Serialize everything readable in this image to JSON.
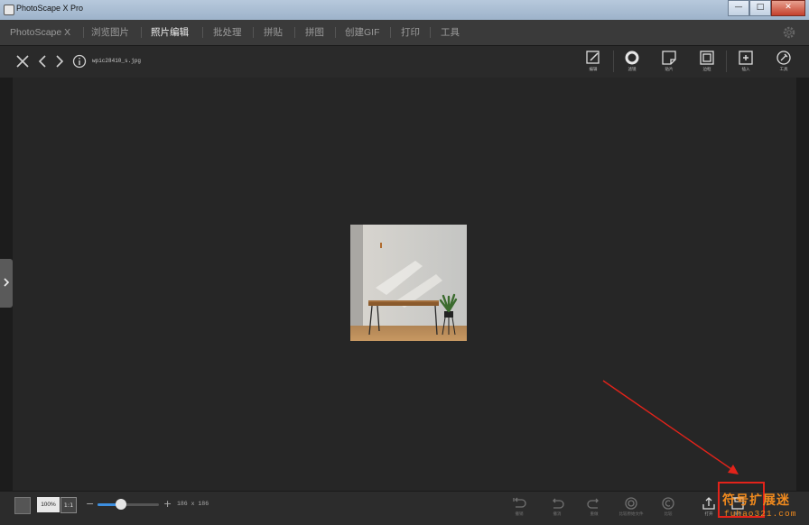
{
  "window": {
    "title": "PhotoScape X Pro",
    "controls": {
      "minimize": "—",
      "maximize": "□",
      "close": "✕"
    }
  },
  "menu": {
    "tabs": [
      {
        "label": "PhotoScape X",
        "active": false
      },
      {
        "label": "浏览图片",
        "active": false
      },
      {
        "label": "照片编辑",
        "active": true
      },
      {
        "label": "批处理",
        "active": false
      },
      {
        "label": "拼贴",
        "active": false
      },
      {
        "label": "拼图",
        "active": false
      },
      {
        "label": "创建GIF",
        "active": false
      },
      {
        "label": "打印",
        "active": false
      },
      {
        "label": "工具",
        "active": false
      }
    ],
    "settings_icon": "gear-icon"
  },
  "toolbar": {
    "nav_icons": [
      "close-icon",
      "chevron-left-icon",
      "chevron-right-icon",
      "info-icon"
    ],
    "filename": "wpic28410_s.jpg",
    "tools": [
      {
        "label": "编辑",
        "icon": "edit-icon"
      },
      {
        "label": "滤镜",
        "icon": "circle-icon"
      },
      {
        "label": "贴片",
        "icon": "sticker-icon"
      },
      {
        "label": "边框",
        "icon": "frame-icon"
      },
      {
        "label": "插入",
        "icon": "insert-icon"
      },
      {
        "label": "工具",
        "icon": "tools-icon"
      }
    ]
  },
  "statusbar": {
    "zoom": "100%",
    "fit_label": "1:1",
    "zoom_level": 0.38,
    "dimensions": "186 x 186",
    "zoom_minus": "−",
    "zoom_plus": "+",
    "actions": [
      {
        "label": "撤销",
        "icon": "undo-all-icon"
      },
      {
        "label": "撤消",
        "icon": "undo-icon"
      },
      {
        "label": "重做",
        "icon": "redo-icon"
      },
      {
        "label": "比较原始文件",
        "icon": "compare-icon"
      },
      {
        "label": "比较",
        "icon": "compare-c-icon"
      },
      {
        "label": "打开",
        "icon": "share-icon"
      },
      {
        "label": "保存",
        "icon": "save-icon"
      }
    ]
  },
  "watermark": {
    "line1": "符号扩展迷",
    "line2": "fuhao321.com"
  },
  "colors": {
    "accent": "#3d8fe0",
    "annotation": "#e2231a",
    "watermark": "#f28b1e"
  }
}
